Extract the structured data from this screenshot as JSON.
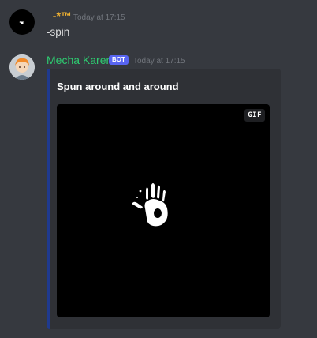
{
  "messages": [
    {
      "username": "_-*™",
      "timestamp": "Today at 17:15",
      "content": "-spin",
      "username_color": "#f0b232"
    },
    {
      "username": "Mecha Karen",
      "bot_tag": "BOT",
      "timestamp": "Today at 17:15",
      "username_color": "#2ecc71",
      "embed": {
        "title": "Spun around and around",
        "accent_color": "#1f3a8f",
        "gif_badge": "GIF",
        "image_icon": "white-handprint-icon"
      }
    }
  ]
}
